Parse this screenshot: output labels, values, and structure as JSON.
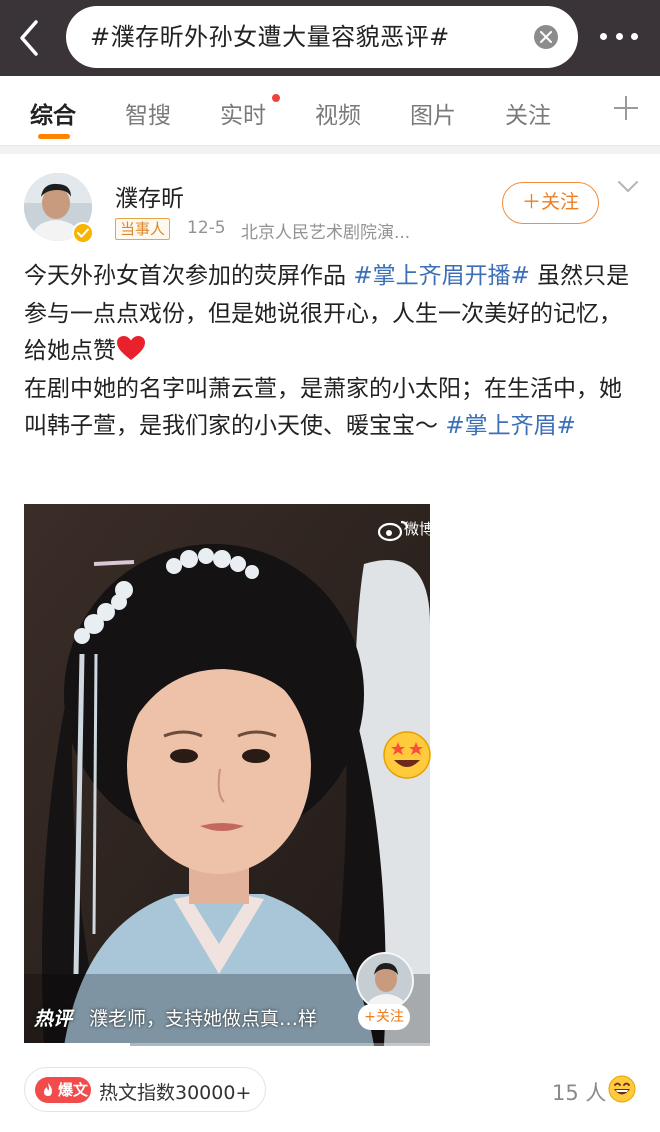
{
  "search": {
    "query": "#濮存昕外孙女遭大量容貌恶评#"
  },
  "tabs": [
    {
      "label": "综合",
      "active": true
    },
    {
      "label": "智搜"
    },
    {
      "label": "实时",
      "has_dot": true
    },
    {
      "label": "视频"
    },
    {
      "label": "图片"
    },
    {
      "label": "关注"
    }
  ],
  "post": {
    "author": "濮存昕",
    "role_badge": "当事人",
    "date": "12-5",
    "source": "北京人民艺术剧院演...",
    "follow_label": "＋关注",
    "text_1a": "今天外孙女首次参加的荧屏作品 ",
    "topic_1": "#掌上齐眉开播#",
    "text_1b": " 虽然只是参与一点点戏份，但是她说很开心，人生一次美好的记忆，给她点赞",
    "text_2a": "在剧中她的名字叫萧云萱，是萧家的小太阳；在生活中，她叫韩子萱，是我们家的小天使、暖宝宝～ ",
    "topic_2": "#掌上齐眉#"
  },
  "video": {
    "watermark": "微博",
    "hot_label": "热评",
    "hot_comment": "濮老师，支持她做点真…样",
    "mini_follow_label": "+关注",
    "progress": 0.26
  },
  "footer": {
    "badge": "爆文",
    "hot_index": "热文指数30000+",
    "likes": "15 人"
  },
  "colors": {
    "accent": "#ff8200",
    "topic": "#3c6fb6",
    "topbar": "#3a3337"
  },
  "icons": [
    "back-arrow-icon",
    "clear-icon",
    "more-icon",
    "plus-icon",
    "verified-icon",
    "chevron-down-icon",
    "heart-emoji-icon",
    "weibo-logo-icon",
    "star-eyes-emoji-icon",
    "fire-icon",
    "laugh-emoji-icon"
  ]
}
